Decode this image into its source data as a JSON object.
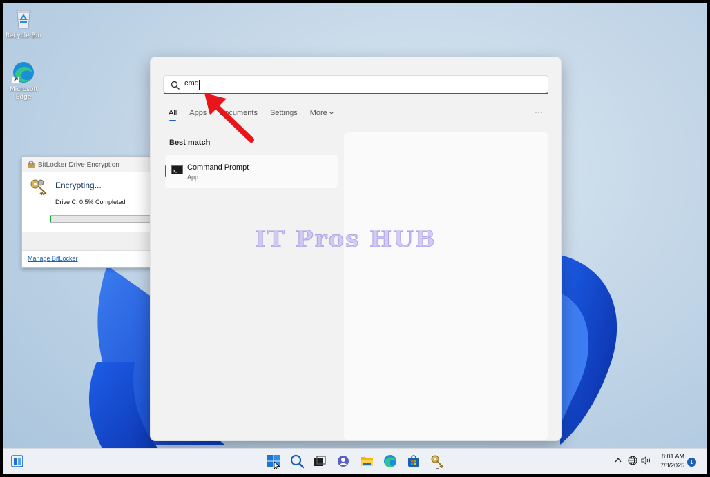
{
  "desktop": {
    "icons": [
      {
        "label": "Recycle Bin",
        "icon": "recycle-bin-icon"
      },
      {
        "label": "Microsoft Edge",
        "icon": "edge-icon"
      }
    ],
    "watermark": "IT Pros HUB"
  },
  "bitlocker": {
    "title": "BitLocker Drive Encryption",
    "heading": "Encrypting...",
    "status": "Drive C: 0.5% Completed",
    "progress_percent": 0.5,
    "link": "Manage BitLocker"
  },
  "search": {
    "query": "cmd",
    "tabs": [
      {
        "label": "All",
        "active": true
      },
      {
        "label": "Apps",
        "active": false
      },
      {
        "label": "Documents",
        "active": false
      },
      {
        "label": "Settings",
        "active": false
      },
      {
        "label": "More",
        "active": false
      }
    ],
    "more_options_glyph": "···",
    "best_match_label": "Best match",
    "result": {
      "name": "Command Prompt",
      "type": "App",
      "icon": "command-prompt-icon"
    }
  },
  "taskbar": {
    "apps": [
      "start-icon",
      "search-icon",
      "task-view-icon",
      "chat-icon",
      "file-explorer-icon",
      "edge-icon",
      "store-icon",
      "bitlocker-icon"
    ],
    "clock": {
      "time": "8:01 AM",
      "date": "7/8/2025"
    },
    "notification_count": "1"
  },
  "colors": {
    "accent": "#1d5fb8",
    "arrow": "#e8151b",
    "progress": "#06b025"
  }
}
